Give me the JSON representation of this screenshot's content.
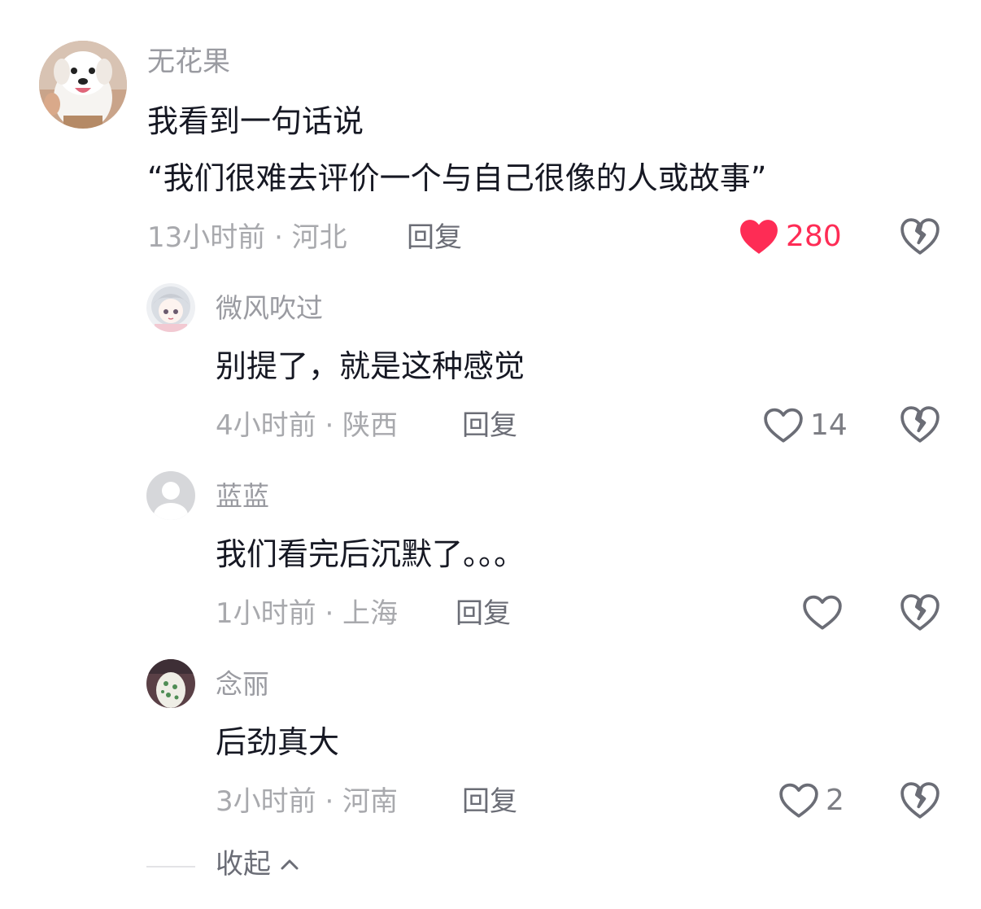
{
  "colors": {
    "liked_heart": "#fe2c55",
    "username": "#9a9ba1",
    "text": "#161823",
    "meta": "#a8a9ad",
    "action": "#6b6d76"
  },
  "main_comment": {
    "username": "无花果",
    "line1": "我看到一句话说",
    "line2": "“我们很难去评价一个与自己很像的人或故事”",
    "time_location": "13小时前 · 河北",
    "reply_label": "回复",
    "likes": "280",
    "liked": true,
    "avatar_icon": "white-puppy-avatar"
  },
  "replies": [
    {
      "username": "微风吹过",
      "text": "别提了，就是这种感觉",
      "time_location": "4小时前 · 陕西",
      "reply_label": "回复",
      "likes": "14",
      "avatar_icon": "anime-girl-avatar"
    },
    {
      "username": "蓝蓝",
      "text": "我们看完后沉默了。。。",
      "time_location": "1小时前 · 上海",
      "reply_label": "回复",
      "likes": "",
      "avatar_icon": "default-user-avatar"
    },
    {
      "username": "念丽",
      "text": "后劲真大",
      "time_location": "3小时前 · 河南",
      "reply_label": "回复",
      "likes": "2",
      "avatar_icon": "floral-avatar"
    }
  ],
  "collapse_label": "收起"
}
